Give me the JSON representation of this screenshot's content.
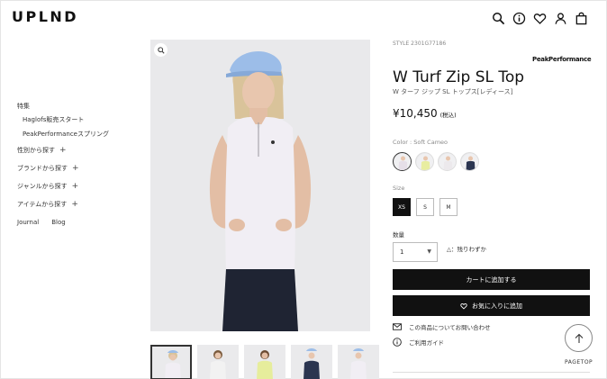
{
  "header": {
    "logo": "UPLND",
    "icons": [
      "search-icon",
      "info-icon",
      "heart-icon",
      "user-icon",
      "bag-icon"
    ]
  },
  "sidebar": {
    "items": [
      {
        "label": "特集"
      },
      {
        "label": "Haglofs販売スタート"
      },
      {
        "label": "PeakPerformanceスプリング"
      },
      {
        "label": "性別から探す",
        "expand": "+"
      },
      {
        "label": "ブランドから探す",
        "expand": "+"
      },
      {
        "label": "ジャンルから探す",
        "expand": "+"
      },
      {
        "label": "アイテムから探す",
        "expand": "+"
      }
    ],
    "footer": [
      "Journal",
      "Blog"
    ]
  },
  "product": {
    "style": "STYLE 2301G77186",
    "brand": "PeakPerformance",
    "title": "W Turf Zip SL Top",
    "subtitle": "W ターフ ジップ SL トップス[レディース]",
    "price": "¥10,450",
    "tax": "(税込)",
    "color_label": "Color : Soft Cameo",
    "size_label": "Size",
    "sizes": [
      "XS",
      "S",
      "M"
    ],
    "selected_size": "XS",
    "qty_label": "数量",
    "qty_value": "1",
    "stock_note": "△：残りわずか",
    "add_to_cart": "カートに追加する",
    "add_to_favorites": "お気に入りに追加",
    "contact": "この商品についてお問い合わせ",
    "guide": "ご利用ガイド"
  },
  "swatch_colors": [
    "#e6dfe8",
    "#e8eda0",
    "#ece9ec",
    "#2b3550"
  ],
  "pagetop": "PAGETOP"
}
